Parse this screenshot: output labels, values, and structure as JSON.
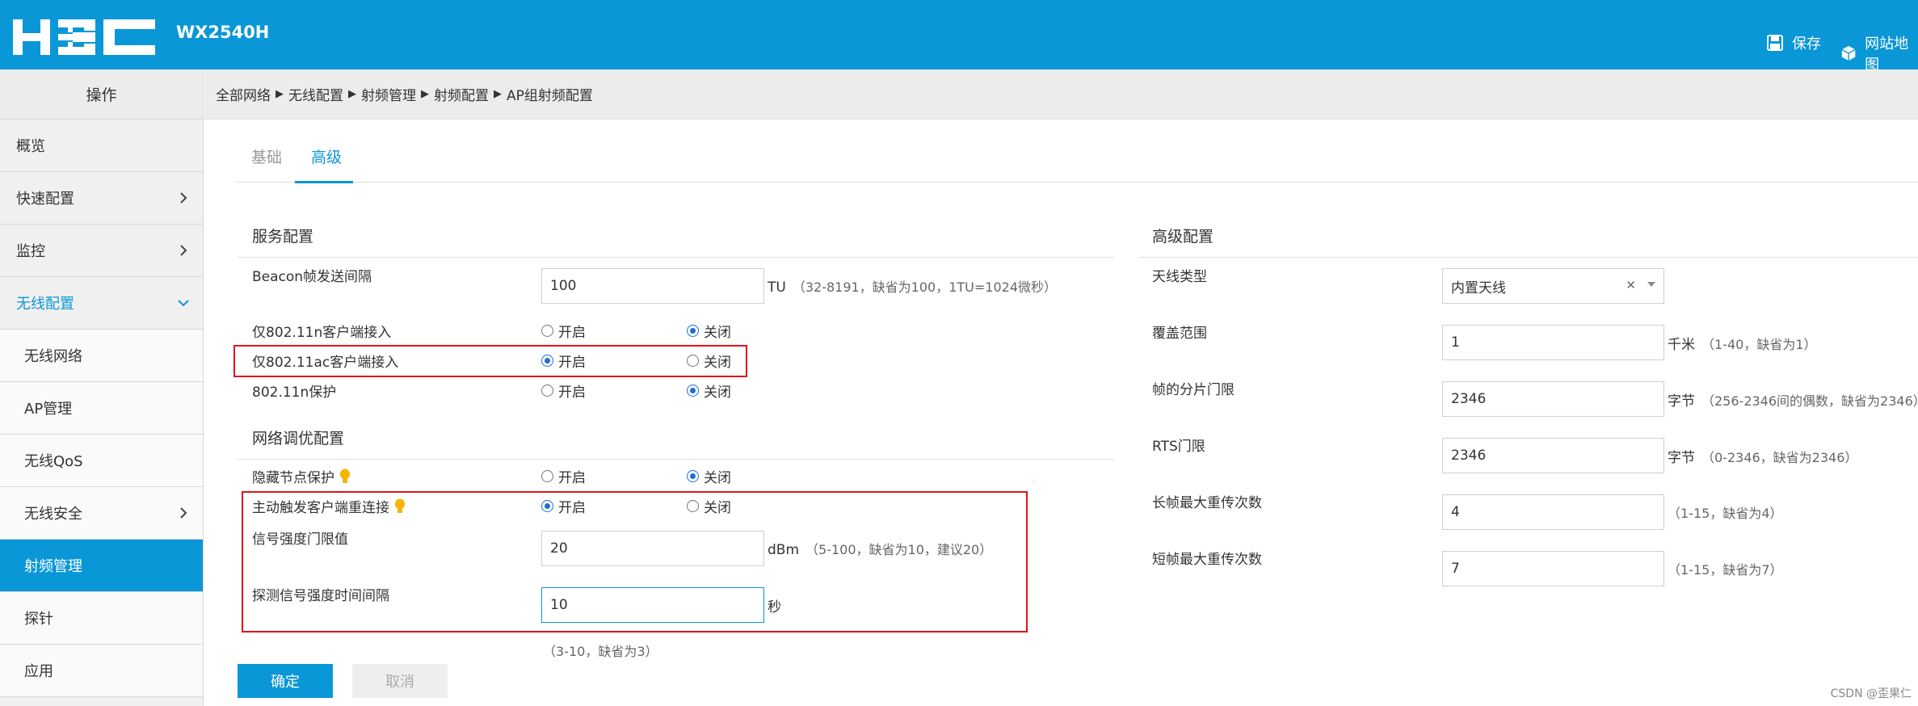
{
  "header": {
    "model": "WX2540H",
    "save_label": "保存",
    "sitemap_label": "网站地图"
  },
  "sidebar": {
    "title": "操作",
    "items": [
      {
        "label": "概览"
      },
      {
        "label": "快速配置"
      },
      {
        "label": "监控"
      },
      {
        "label": "无线配置"
      },
      {
        "label": "无线网络"
      },
      {
        "label": "AP管理"
      },
      {
        "label": "无线QoS"
      },
      {
        "label": "无线安全"
      },
      {
        "label": "射频管理"
      },
      {
        "label": "探针"
      },
      {
        "label": "应用"
      }
    ]
  },
  "breadcrumb": [
    "全部网络",
    "无线配置",
    "射频管理",
    "射频配置",
    "AP组射频配置"
  ],
  "tabs": [
    {
      "label": "基础"
    },
    {
      "label": "高级"
    }
  ],
  "service": {
    "title": "服务配置",
    "beacon_label": "Beacon帧发送间隔",
    "beacon_value": "100",
    "beacon_unit": "TU",
    "beacon_hint": "（32-8191，缺省为100，1TU=1024微秒）",
    "n_only_label": "仅802.11n客户端接入",
    "ac_only_label": "仅802.11ac客户端接入",
    "n_protect_label": "802.11n保护",
    "on_label": "开启",
    "off_label": "关闭",
    "n_only_value": "关闭",
    "ac_only_value": "开启",
    "n_protect_value": "关闭"
  },
  "tuning": {
    "title": "网络调优配置",
    "hidden_node_label": "隐藏节点保护",
    "hidden_node_value": "关闭",
    "reconnect_label": "主动触发客户端重连接",
    "reconnect_value": "开启",
    "rssi_label": "信号强度门限值",
    "rssi_value": "20",
    "rssi_unit": "dBm",
    "rssi_hint": "（5-100，缺省为10，建议20）",
    "interval_label": "探测信号强度时间间隔",
    "interval_value": "10",
    "interval_unit": "秒",
    "interval_hint": "（3-10，缺省为3）"
  },
  "advanced": {
    "title": "高级配置",
    "antenna_label": "天线类型",
    "antenna_value": "内置天线",
    "coverage_label": "覆盖范围",
    "coverage_value": "1",
    "coverage_unit": "千米",
    "coverage_hint": "（1-40，缺省为1）",
    "frag_label": "帧的分片门限",
    "frag_value": "2346",
    "frag_unit": "字节",
    "frag_hint": "（256-2346间的偶数，缺省为2346）",
    "rts_label": "RTS门限",
    "rts_value": "2346",
    "rts_unit": "字节",
    "rts_hint": "（0-2346，缺省为2346）",
    "long_retry_label": "长帧最大重传次数",
    "long_retry_value": "4",
    "long_retry_hint": "（1-15，缺省为4）",
    "short_retry_label": "短帧最大重传次数",
    "short_retry_value": "7",
    "short_retry_hint": "（1-15，缺省为7）"
  },
  "actions": {
    "ok_label": "确定",
    "cancel_label": "取消"
  },
  "watermark": "CSDN @歪果仁",
  "colors": {
    "brand": "#0a97d7",
    "highlight_box": "#e0141a"
  }
}
